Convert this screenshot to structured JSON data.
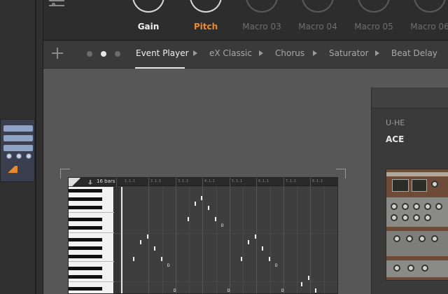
{
  "macros": [
    {
      "label": "Gain",
      "style": "white",
      "active": true
    },
    {
      "label": "Pitch",
      "style": "orange",
      "active": true
    },
    {
      "label": "Macro 03",
      "style": "dim",
      "active": false
    },
    {
      "label": "Macro 04",
      "style": "dim",
      "active": false
    },
    {
      "label": "Macro 05",
      "style": "dim",
      "active": false
    },
    {
      "label": "Macro 06",
      "style": "dim",
      "active": false
    }
  ],
  "chain": {
    "tabs": [
      "Event Player",
      "eX Classic",
      "Chorus",
      "Saturator",
      "Beat Delay"
    ],
    "active_index": 0,
    "page_count": 3,
    "current_page": 2
  },
  "piano_roll": {
    "length_label": "16 bars",
    "ruler": [
      "1.1.1",
      "2.1.1",
      "3.1.1",
      "4.1.1",
      "5.1.1",
      "6.1.1",
      "7.1.1",
      "8.1.1"
    ],
    "note_letters": [
      "D",
      "D",
      "D",
      "D",
      "D",
      "D"
    ]
  },
  "device": {
    "vendor": "U-HE",
    "name": "ACE"
  },
  "colors": {
    "accent_orange": "#ee8a2c",
    "workspace": "#575757",
    "panel": "#2d2d2d"
  }
}
